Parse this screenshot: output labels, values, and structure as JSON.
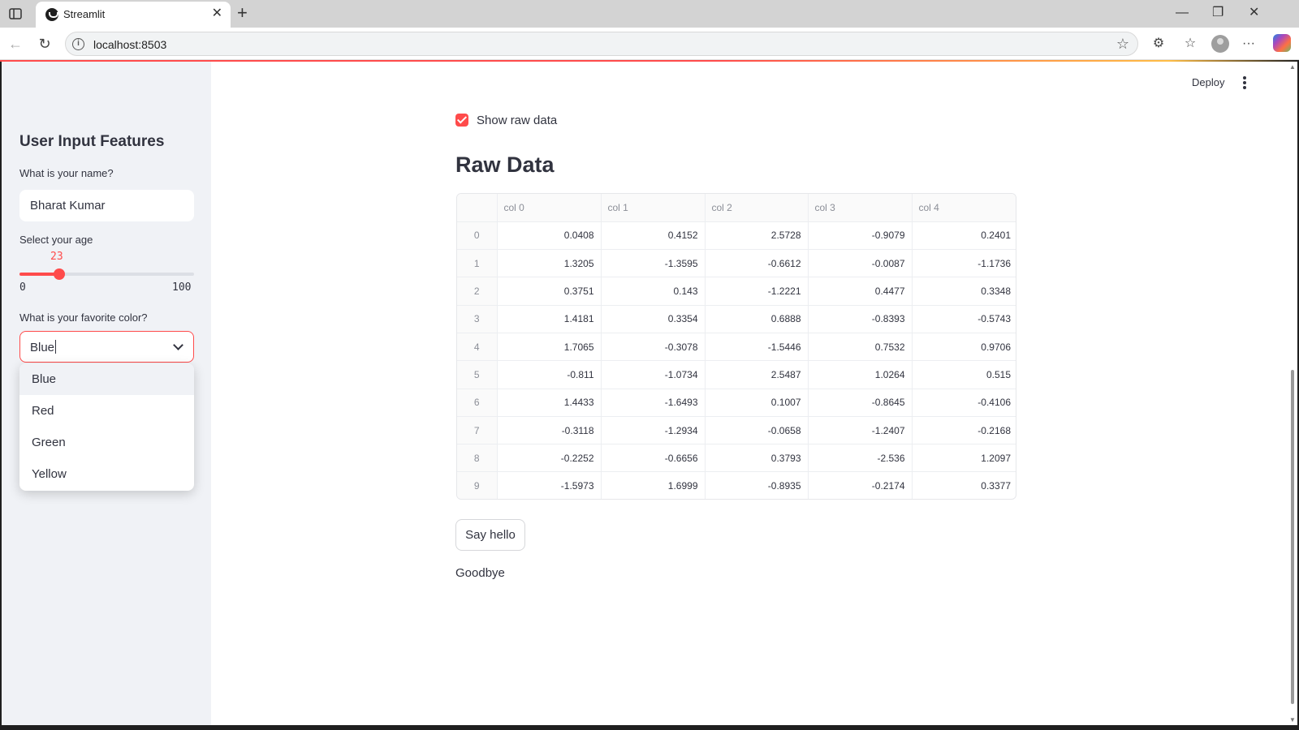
{
  "browser": {
    "tab_title": "Streamlit",
    "url": "localhost:8503"
  },
  "app_header": {
    "deploy_label": "Deploy"
  },
  "sidebar": {
    "title": "User Input Features",
    "name_label": "What is your name?",
    "name_value": "Bharat Kumar",
    "age_label": "Select your age",
    "age_value": "23",
    "age_min": "0",
    "age_max": "100",
    "age_fraction": 0.23,
    "color_label": "What is your favorite color?",
    "color_value": "Blue",
    "color_options": [
      "Blue",
      "Red",
      "Green",
      "Yellow"
    ]
  },
  "main": {
    "checkbox_label": "Show raw data",
    "checkbox_checked": true,
    "title": "Raw Data",
    "table": {
      "columns": [
        "col 0",
        "col 1",
        "col 2",
        "col 3",
        "col 4"
      ],
      "rows": [
        [
          "0",
          "0.0408",
          "0.4152",
          "2.5728",
          "-0.9079",
          "0.2401"
        ],
        [
          "1",
          "1.3205",
          "-1.3595",
          "-0.6612",
          "-0.0087",
          "-1.1736"
        ],
        [
          "2",
          "0.3751",
          "0.143",
          "-1.2221",
          "0.4477",
          "0.3348"
        ],
        [
          "3",
          "1.4181",
          "0.3354",
          "0.6888",
          "-0.8393",
          "-0.5743"
        ],
        [
          "4",
          "1.7065",
          "-0.3078",
          "-1.5446",
          "0.7532",
          "0.9706"
        ],
        [
          "5",
          "-0.811",
          "-1.0734",
          "2.5487",
          "1.0264",
          "0.515"
        ],
        [
          "6",
          "1.4433",
          "-1.6493",
          "0.1007",
          "-0.8645",
          "-0.4106"
        ],
        [
          "7",
          "-0.3118",
          "-1.2934",
          "-0.0658",
          "-1.2407",
          "-0.2168"
        ],
        [
          "8",
          "-0.2252",
          "-0.6656",
          "0.3793",
          "-2.536",
          "1.2097"
        ],
        [
          "9",
          "-1.5973",
          "1.6999",
          "-0.8935",
          "-0.2174",
          "0.3377"
        ]
      ]
    },
    "button_label": "Say hello",
    "output_text": "Goodbye"
  },
  "colors": {
    "accent": "#ff4b4b",
    "sidebar_bg": "#f0f2f6",
    "text": "#31333f"
  }
}
